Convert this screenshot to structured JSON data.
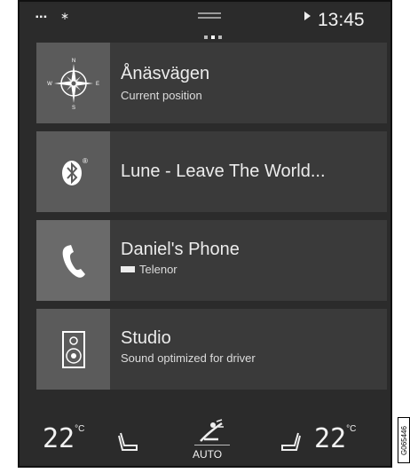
{
  "status_bar": {
    "time": "13:45",
    "icons": [
      "signal-icon",
      "bluetooth-icon",
      "play-icon"
    ]
  },
  "tiles": [
    {
      "title": "Ånäsvägen",
      "subtitle": "Current position",
      "icon": "compass-icon"
    },
    {
      "title": "Lune - Leave The World...",
      "subtitle": "",
      "icon": "bluetooth-icon"
    },
    {
      "title": "Daniel's Phone",
      "subtitle": "Telenor",
      "icon": "phone-icon"
    },
    {
      "title": "Studio",
      "subtitle": "Sound optimized for driver",
      "icon": "speaker-icon"
    }
  ],
  "climate": {
    "left_temp": "22",
    "right_temp": "22",
    "unit": "°C",
    "fan_mode": "AUTO"
  },
  "side_code": "G065446"
}
